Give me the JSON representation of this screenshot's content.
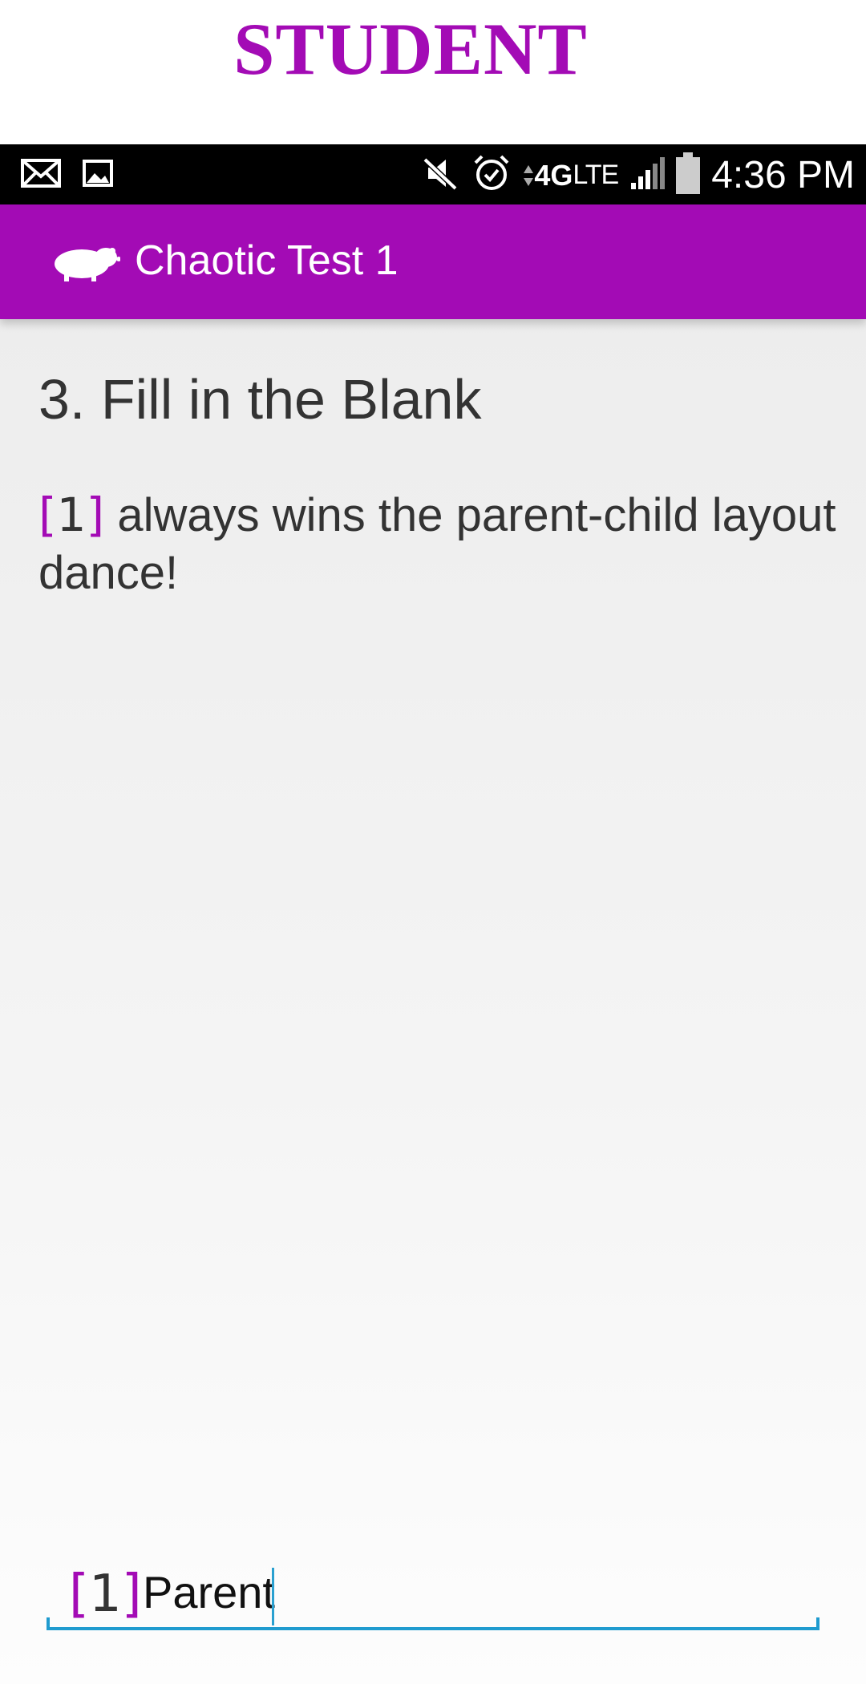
{
  "banner": {
    "text": "STUDENT"
  },
  "status_bar": {
    "left_icons": [
      "mail-icon",
      "image-icon"
    ],
    "right_icons": [
      "vibrate-mute-icon",
      "alarm-icon",
      "network-4g-lte-icon",
      "signal-icon",
      "battery-icon"
    ],
    "network_main": "4G",
    "network_sub": "LTE",
    "time": "4:36 PM"
  },
  "app_bar": {
    "logo_icon": "hamster-icon",
    "title": "Chaotic Test 1",
    "color": "#a30bb5"
  },
  "question": {
    "title": "3. Fill in the Blank",
    "blank_marker": {
      "open": "[",
      "number": "1",
      "close": "]"
    },
    "text": "always wins the parent-child layout dance!"
  },
  "answer": {
    "blank_marker": {
      "open": "[",
      "number": "1",
      "close": "]"
    },
    "value": "Parent",
    "underline_color": "#1f9bcf"
  }
}
